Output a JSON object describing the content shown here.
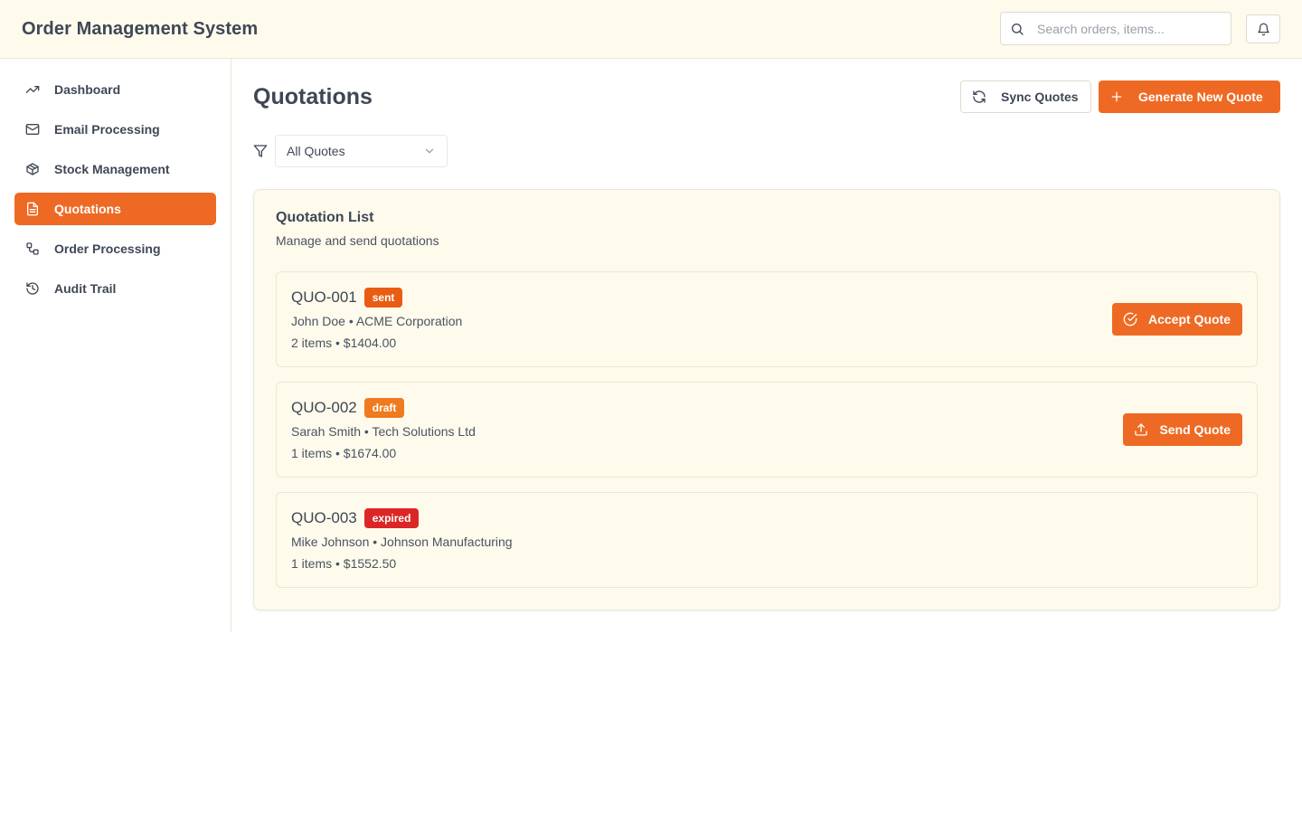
{
  "header": {
    "title": "Order Management System",
    "search_placeholder": "Search orders, items...",
    "search_value": ""
  },
  "colors": {
    "accent": "#ee6a24",
    "sent": "#e85d14",
    "draft": "#f07a1f",
    "expired": "#dc2626",
    "header_bg": "#fefbec"
  },
  "sidebar": {
    "items": [
      {
        "label": "Dashboard",
        "icon": "trending-up-icon",
        "active": false
      },
      {
        "label": "Email Processing",
        "icon": "mail-icon",
        "active": false
      },
      {
        "label": "Stock Management",
        "icon": "package-icon",
        "active": false
      },
      {
        "label": "Quotations",
        "icon": "file-text-icon",
        "active": true
      },
      {
        "label": "Order Processing",
        "icon": "workflow-icon",
        "active": false
      },
      {
        "label": "Audit Trail",
        "icon": "history-icon",
        "active": false
      }
    ]
  },
  "main": {
    "title": "Quotations",
    "sync_label": "Sync Quotes",
    "generate_label": "Generate New Quote",
    "filter": {
      "selected": "All Quotes"
    },
    "list": {
      "title": "Quotation List",
      "subtitle": "Manage and send quotations",
      "quotes": [
        {
          "id": "QUO-001",
          "status": "sent",
          "line1": "John Doe • ACME Corporation",
          "line2": "2 items • $1404.00",
          "action": "Accept Quote",
          "action_icon": "check-circle-icon"
        },
        {
          "id": "QUO-002",
          "status": "draft",
          "line1": "Sarah Smith • Tech Solutions Ltd",
          "line2": "1 items • $1674.00",
          "action": "Send Quote",
          "action_icon": "upload-icon"
        },
        {
          "id": "QUO-003",
          "status": "expired",
          "line1": "Mike Johnson • Johnson Manufacturing",
          "line2": "1 items • $1552.50",
          "action": null,
          "action_icon": null
        }
      ]
    }
  }
}
